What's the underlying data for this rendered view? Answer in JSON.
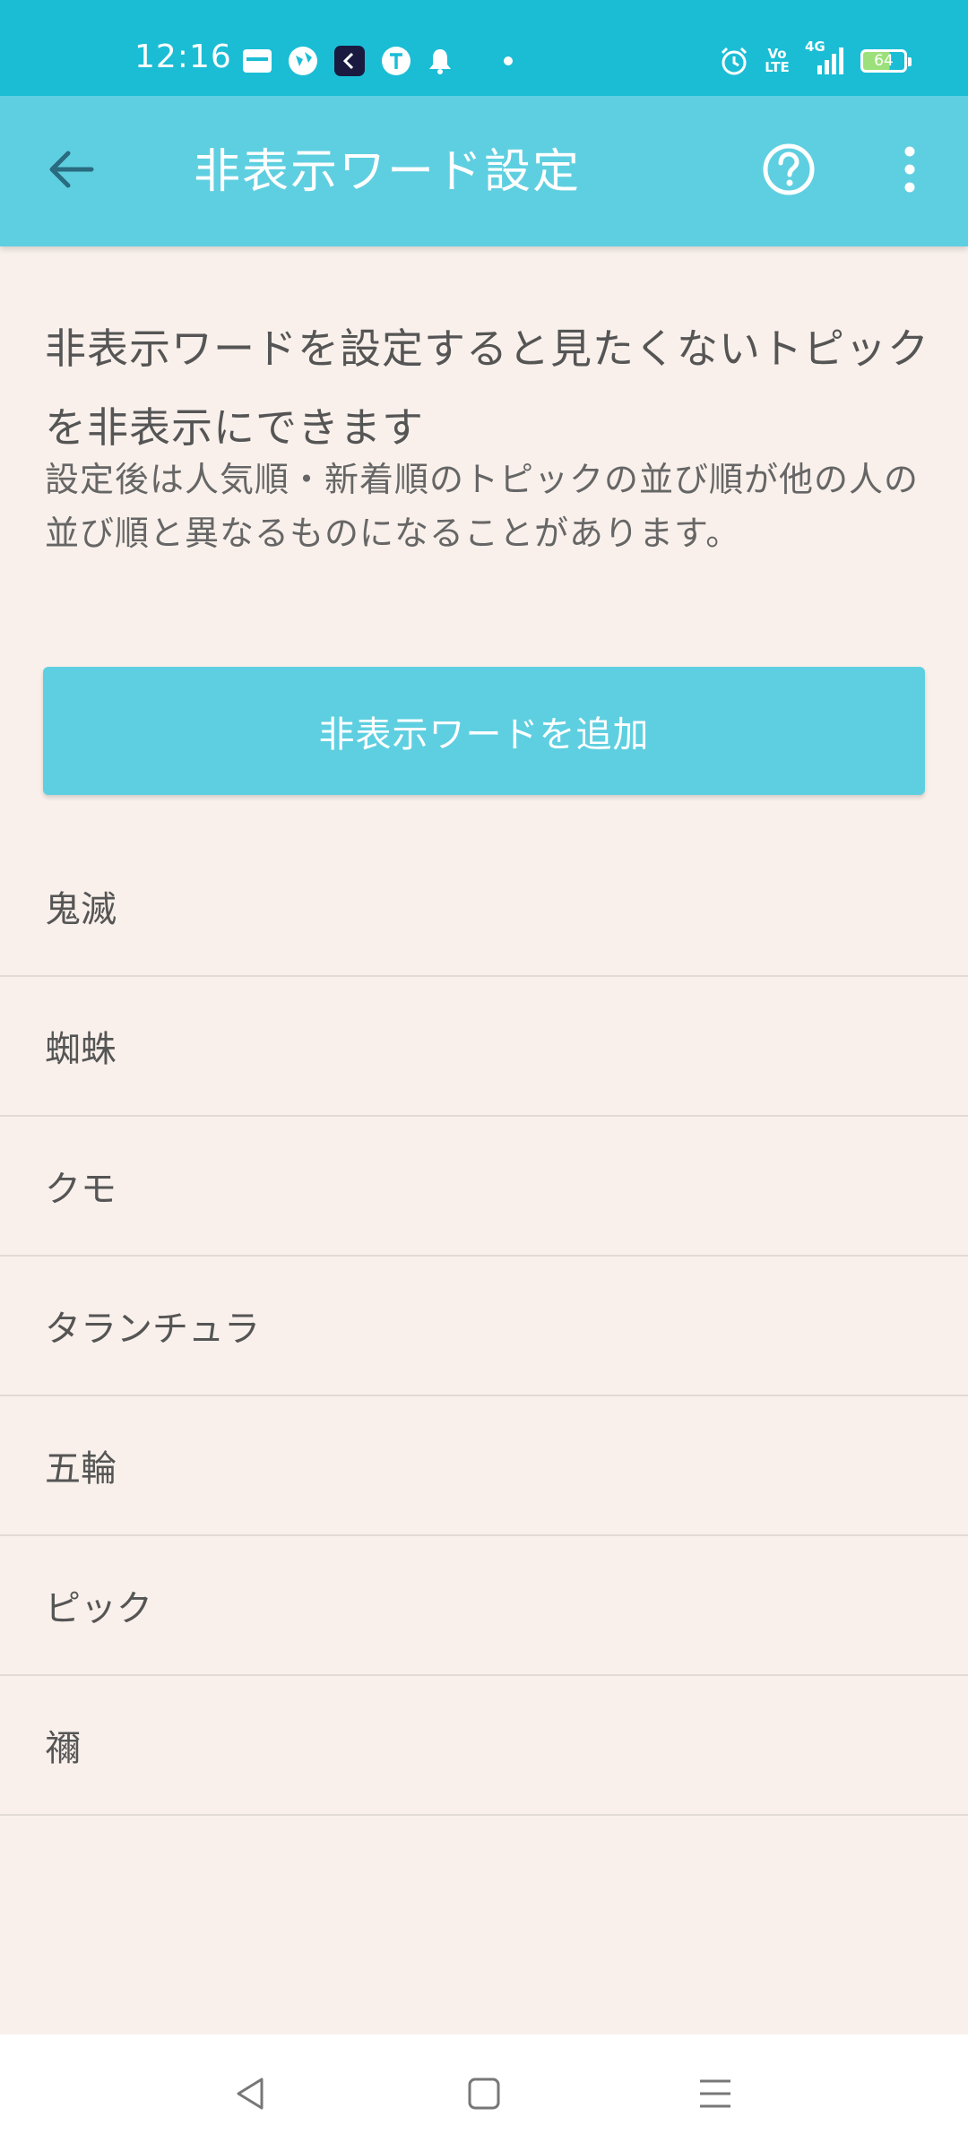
{
  "status_bar": {
    "time": "12:16",
    "battery_level": "64",
    "network": "4G",
    "volte": "Vo LTE"
  },
  "app_bar": {
    "title": "非表示ワード設定"
  },
  "description": {
    "main": "非表示ワードを設定すると見たくないトピックを非表示にできます",
    "sub": "設定後は人気順・新着順のトピックの並び順が他の人の並び順と異なるものになることがあります。"
  },
  "add_button_label": "非表示ワードを追加",
  "hidden_words": [
    "鬼滅",
    "蜘蛛",
    "クモ",
    "タランチュラ",
    "五輪",
    "ピック",
    "禰"
  ],
  "colors": {
    "status_bar": "#1bbdd5",
    "app_bar": "#5ecfe0",
    "accent": "#5ecfe0",
    "background": "#f9f0eb"
  }
}
